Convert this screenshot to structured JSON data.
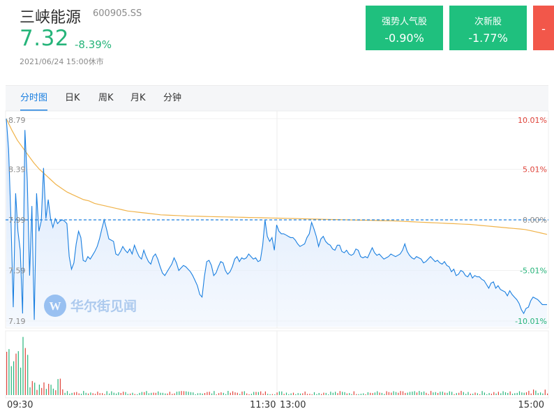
{
  "header": {
    "name": "三峡能源",
    "code": "600905.SS",
    "price": "7.32",
    "change_pct": "-8.39%",
    "timestamp": "2021/06/24 15:00休市"
  },
  "sectors": [
    {
      "name": "强势人气股",
      "value": "-0.90%"
    },
    {
      "name": "次新股",
      "value": "-1.77%"
    },
    {
      "name": "",
      "value": "-"
    }
  ],
  "tabs": [
    {
      "label": "分时图"
    },
    {
      "label": "日K"
    },
    {
      "label": "周K"
    },
    {
      "label": "月K"
    },
    {
      "label": "分钟"
    }
  ],
  "watermark": "华尔街见闻",
  "colors": {
    "up": "#f2574a",
    "down": "#26b47a",
    "price_line": "#1a7fe0",
    "avg_line": "#f0b34a",
    "accent": "#1a7fe0"
  },
  "chart_data": {
    "type": "line",
    "prev_close": 7.99,
    "ylim": [
      7.19,
      8.79
    ],
    "y_ticks_left": [
      "8.79",
      "8.39",
      "7.99",
      "7.59",
      "7.19"
    ],
    "y_ticks_right": [
      "10.01%",
      "5.01%",
      "0.00%",
      "-5.01%",
      "-10.01%"
    ],
    "x_labels": [
      "09:30",
      "11:30",
      "13:00",
      "15:00"
    ],
    "series": [
      {
        "key": "price",
        "values": [
          8.79,
          8.55,
          7.99,
          7.3,
          8.2,
          7.9,
          7.75,
          7.25,
          8.7,
          8.3,
          7.55,
          8.1,
          7.2,
          8.2,
          7.9,
          7.98,
          8.4,
          8.0,
          8.15,
          8.0,
          7.93,
          8.0,
          7.96,
          7.98,
          7.99,
          7.98,
          7.96,
          7.7,
          7.6,
          7.65,
          7.8,
          7.9,
          7.85,
          7.67,
          7.66,
          7.7,
          7.68,
          7.71,
          7.74,
          7.78,
          7.84,
          7.92,
          7.99,
          7.92,
          7.84,
          7.83,
          7.82,
          7.72,
          7.71,
          7.74,
          7.78,
          7.75,
          7.73,
          7.76,
          7.72,
          7.79,
          7.74,
          7.7,
          7.68,
          7.75,
          7.7,
          7.66,
          7.64,
          7.7,
          7.72,
          7.68,
          7.62,
          7.57,
          7.55,
          7.58,
          7.61,
          7.64,
          7.69,
          7.65,
          7.59,
          7.61,
          7.63,
          7.62,
          7.6,
          7.58,
          7.55,
          7.51,
          7.47,
          7.4,
          7.38,
          7.54,
          7.66,
          7.67,
          7.63,
          7.55,
          7.57,
          7.62,
          7.66,
          7.65,
          7.59,
          7.56,
          7.58,
          7.62,
          7.68,
          7.7,
          7.66,
          7.69,
          7.68,
          7.69,
          7.72,
          7.7,
          7.68,
          7.69,
          7.66,
          7.67,
          7.79,
          7.99,
          7.86,
          7.82,
          7.85,
          7.75,
          7.95,
          7.9,
          7.88,
          7.88,
          7.87,
          7.86,
          7.85,
          7.85,
          7.83,
          7.8,
          7.78,
          7.79,
          7.8,
          7.85,
          7.88,
          7.97,
          7.92,
          7.86,
          7.78,
          7.84,
          7.86,
          7.82,
          7.8,
          7.79,
          7.76,
          7.75,
          7.79,
          7.79,
          7.74,
          7.73,
          7.75,
          7.72,
          7.71,
          7.72,
          7.76,
          7.75,
          7.7,
          7.69,
          7.7,
          7.69,
          7.73,
          7.77,
          7.73,
          7.71,
          7.72,
          7.7,
          7.68,
          7.69,
          7.7,
          7.72,
          7.71,
          7.7,
          7.71,
          7.72,
          7.75,
          7.8,
          7.74,
          7.71,
          7.69,
          7.68,
          7.7,
          7.69,
          7.68,
          7.65,
          7.66,
          7.68,
          7.7,
          7.68,
          7.66,
          7.67,
          7.65,
          7.64,
          7.66,
          7.63,
          7.62,
          7.58,
          7.6,
          7.55,
          7.56,
          7.59,
          7.58,
          7.55,
          7.54,
          7.57,
          7.53,
          7.55,
          7.54,
          7.54,
          7.52,
          7.51,
          7.48,
          7.45,
          7.49,
          7.5,
          7.45,
          7.47,
          7.44,
          7.43,
          7.42,
          7.39,
          7.43,
          7.4,
          7.38,
          7.36,
          7.33,
          7.28,
          7.25,
          7.29,
          7.3,
          7.35,
          7.38,
          7.37,
          7.36,
          7.34,
          7.32,
          7.32,
          7.32
        ]
      },
      {
        "key": "average",
        "values": [
          8.79,
          8.7,
          8.62,
          8.56,
          8.5,
          8.44,
          8.39,
          8.35,
          8.31,
          8.27,
          8.24,
          8.21,
          8.19,
          8.17,
          8.15,
          8.14,
          8.12,
          8.11,
          8.1,
          8.09,
          8.08,
          8.07,
          8.06,
          8.055,
          8.05,
          8.045,
          8.04,
          8.035,
          8.03,
          8.028,
          8.026,
          8.024,
          8.022,
          8.02,
          8.019,
          8.018,
          8.017,
          8.016,
          8.015,
          8.014,
          8.013,
          8.012,
          8.011,
          8.01,
          8.009,
          8.008,
          8.007,
          8.006,
          8.005,
          8.004,
          8.003,
          8.002,
          8.001,
          8.0,
          7.998,
          7.997,
          7.996,
          7.995,
          7.994,
          7.993,
          7.992,
          7.991,
          7.99,
          7.989,
          7.988,
          7.987,
          7.986,
          7.985,
          7.984,
          7.983,
          7.982,
          7.98,
          7.978,
          7.976,
          7.974,
          7.972,
          7.97,
          7.968,
          7.966,
          7.964,
          7.962,
          7.96,
          7.958,
          7.956,
          7.954,
          7.95,
          7.946,
          7.942,
          7.938,
          7.934,
          7.93,
          7.926,
          7.922,
          7.918,
          7.914,
          7.905,
          7.895,
          7.885,
          7.875
        ]
      }
    ],
    "volume_note": "bars"
  }
}
